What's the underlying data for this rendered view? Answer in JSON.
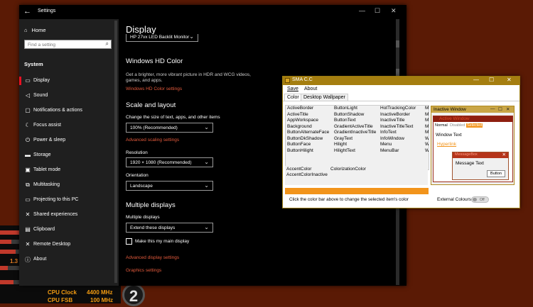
{
  "desktop": {
    "cpu_mini_value": "1.3",
    "cpu_clock_label": "CPU Clock",
    "cpu_clock_value": "4400 MHz",
    "cpu_fsb_label": "CPU FSB",
    "cpu_fsb_value": "100 MHz",
    "logo_text": "2"
  },
  "settings": {
    "window_title": "Settings",
    "home": "Home",
    "search_placeholder": "Find a setting",
    "section": "System",
    "nav": [
      {
        "label": "Display",
        "icon": "monitor-icon",
        "glyph": "▭"
      },
      {
        "label": "Sound",
        "icon": "speaker-icon",
        "glyph": "◁"
      },
      {
        "label": "Notifications & actions",
        "icon": "notifications-icon",
        "glyph": "▢"
      },
      {
        "label": "Focus assist",
        "icon": "moon-icon",
        "glyph": "☾"
      },
      {
        "label": "Power & sleep",
        "icon": "power-icon",
        "glyph": "⏻"
      },
      {
        "label": "Storage",
        "icon": "storage-icon",
        "glyph": "▬"
      },
      {
        "label": "Tablet mode",
        "icon": "tablet-icon",
        "glyph": "▣"
      },
      {
        "label": "Multitasking",
        "icon": "multitasking-icon",
        "glyph": "⧉"
      },
      {
        "label": "Projecting to this PC",
        "icon": "projector-icon",
        "glyph": "▭"
      },
      {
        "label": "Shared experiences",
        "icon": "shared-icon",
        "glyph": "✕"
      },
      {
        "label": "Clipboard",
        "icon": "clipboard-icon",
        "glyph": "▤"
      },
      {
        "label": "Remote Desktop",
        "icon": "remote-desktop-icon",
        "glyph": "✕"
      },
      {
        "label": "About",
        "icon": "info-icon",
        "glyph": "ⓘ"
      }
    ],
    "content": {
      "title": "Display",
      "monitor_select": "HP 27vx LED Backlit Monitor",
      "hd_heading": "Windows HD Color",
      "hd_desc_1": "Get a brighter, more vibrant picture in HDR and WCG videos,",
      "hd_desc_2": "games, and apps.",
      "hd_link": "Windows HD Color settings",
      "scale_heading": "Scale and layout",
      "scale_label": "Change the size of text, apps, and other items",
      "scale_value": "100% (Recommended)",
      "adv_scaling": "Advanced scaling settings",
      "resolution_label": "Resolution",
      "resolution_value": "1920 × 1080 (Recommended)",
      "orientation_label": "Orientation",
      "orientation_value": "Landscape",
      "multi_heading": "Multiple displays",
      "multi_label": "Multiple displays",
      "multi_value": "Extend these displays",
      "main_display": "Make this my main display",
      "adv_display": "Advanced display settings",
      "graphics": "Graphics settings"
    }
  },
  "sma": {
    "title": "SMA C.C",
    "menu_save": "Save",
    "menu_about": "About",
    "tab_color": "Color",
    "tab_wallpaper": "Desktop Wallpaper",
    "col1": [
      "ActiveBorder",
      "ActiveTitle",
      "AppWorkspace",
      "Background",
      "ButtonAlternateFace",
      "ButtonDkShadow",
      "ButtonFace",
      "ButtonHilight"
    ],
    "col2": [
      "ButtonLight",
      "ButtonShadow",
      "ButtonText",
      "GradientActiveTitle",
      "GradientInactiveTitle",
      "GrayText",
      "Hilight",
      "HilightText"
    ],
    "col3": [
      "HotTrackingColor",
      "InactiveBorder",
      "InactiveTitle",
      "InactiveTitleText",
      "InfoText",
      "InfoWindow",
      "Menu",
      "MenuBar"
    ],
    "col4": [
      "M",
      "M",
      "M",
      "M",
      "M",
      "W",
      "W",
      "W"
    ],
    "accent_1": "AccentColor",
    "accent_2": "ColorizationColor",
    "accent_3": "AccentColorInactive",
    "hint": "Click the color bar above to change the selected item's color",
    "bar_color": "#f2941b",
    "preview": {
      "inactive_title": "Inactive Window",
      "active_title": "Active Window",
      "menu_normal": "Normal",
      "menu_disabled": "Disabled",
      "menu_selected": "Selected",
      "window_text": "Window Text",
      "hyperlink": "Hyperlink",
      "msgbox_title": "MessageBox",
      "msgbox_text": "Message Text",
      "button": "Button"
    },
    "external_label": "External Colours",
    "toggle_state": "Off"
  }
}
